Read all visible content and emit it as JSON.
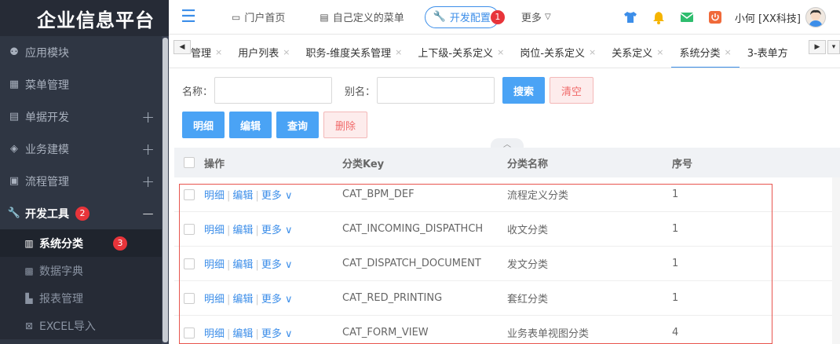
{
  "app": {
    "title": "企业信息平台"
  },
  "sidebar": {
    "items": [
      {
        "label": "应用模块",
        "icon": "app-module-icon",
        "expandable": false
      },
      {
        "label": "菜单管理",
        "icon": "grid-icon",
        "expandable": false
      },
      {
        "label": "单据开发",
        "icon": "document-icon",
        "expandable": true
      },
      {
        "label": "业务建模",
        "icon": "cube-icon",
        "expandable": true
      },
      {
        "label": "流程管理",
        "icon": "flow-icon",
        "expandable": true
      },
      {
        "label": "开发工具",
        "icon": "wrench-icon",
        "expandable": true,
        "active": true,
        "badge": "2",
        "collapse_symbol": "−"
      }
    ],
    "subitems": [
      {
        "label": "系统分类",
        "icon": "calendar-icon",
        "active": true,
        "badge": "3"
      },
      {
        "label": "数据字典",
        "icon": "dictionary-icon"
      },
      {
        "label": "报表管理",
        "icon": "bar-chart-icon"
      },
      {
        "label": "EXCEL导入",
        "icon": "excel-icon"
      }
    ],
    "expand_symbol": "+"
  },
  "topbar": {
    "portal_home": "门户首页",
    "custom_menu": "自己定义的菜单",
    "dev_config": "开发配置",
    "dev_config_badge": "1",
    "more": "更多",
    "user": "小何 [XX科技]"
  },
  "tabs": [
    {
      "label": "管理",
      "active": false
    },
    {
      "label": "用户列表",
      "active": false
    },
    {
      "label": "职务-维度关系管理",
      "active": false
    },
    {
      "label": "上下级-关系定义",
      "active": false
    },
    {
      "label": "岗位-关系定义",
      "active": false
    },
    {
      "label": "关系定义",
      "active": false
    },
    {
      "label": "系统分类",
      "active": true
    },
    {
      "label": "3-表单方",
      "active": false
    }
  ],
  "search": {
    "name_label": "名称：",
    "alias_label": "别名：",
    "name_value": "",
    "alias_value": "",
    "search_button": "搜索",
    "clear_button": "清空"
  },
  "actions": {
    "detail": "明细",
    "edit": "编辑",
    "query": "查询",
    "delete": "删除"
  },
  "grid": {
    "headers": {
      "op": "操作",
      "key": "分类Key",
      "name": "分类名称",
      "order": "序号"
    },
    "row_ops": {
      "detail": "明细",
      "edit": "编辑",
      "more": "更多"
    },
    "rows": [
      {
        "key": "CAT_BPM_DEF",
        "name": "流程定义分类",
        "order": "1"
      },
      {
        "key": "CAT_INCOMING_DISPATHCH",
        "name": "收文分类",
        "order": "1"
      },
      {
        "key": "CAT_DISPATCH_DOCUMENT",
        "name": "发文分类",
        "order": "1"
      },
      {
        "key": "CAT_RED_PRINTING",
        "name": "套红分类",
        "order": "1"
      },
      {
        "key": "CAT_FORM_VIEW",
        "name": "业务表单视图分类",
        "order": "4"
      }
    ]
  },
  "colors": {
    "sidebar_bg": "#2f3643",
    "accent": "#3c8ee9",
    "button_primary": "#4aa3f5",
    "badge": "#e8343a",
    "highlight": "#e8554e"
  }
}
